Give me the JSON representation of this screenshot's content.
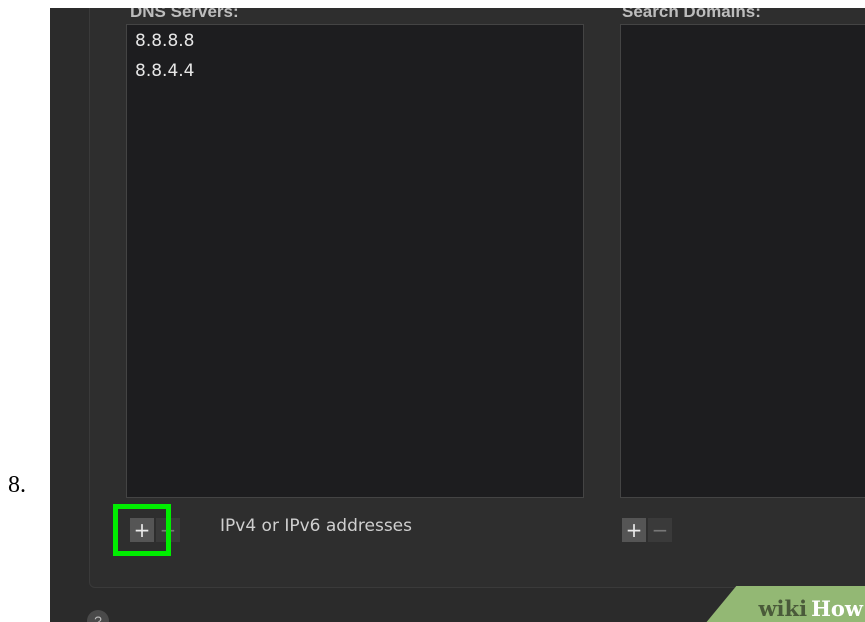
{
  "step_number": "8.",
  "dns_servers": {
    "header": "DNS Servers:",
    "entries": [
      "8.8.8.8",
      "8.8.4.4"
    ],
    "add_label": "+",
    "remove_label": "−",
    "hint": "IPv4 or IPv6 addresses"
  },
  "search_domains": {
    "header": "Search Domains:",
    "add_label": "+",
    "remove_label": "−"
  },
  "help_label": "?",
  "watermark": {
    "wiki": "wiki",
    "how": "How"
  },
  "colors": {
    "highlight": "#00ee00",
    "background": "#2b2b2b",
    "list_bg": "#1d1d1f"
  }
}
